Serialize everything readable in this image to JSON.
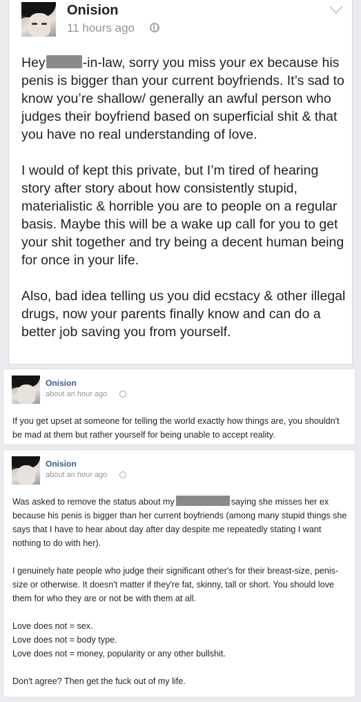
{
  "post1": {
    "author": "Onision",
    "time": "11 hours ago",
    "icons": {
      "privacy": "globe-icon",
      "menu": "chevron-down-icon"
    },
    "p1_a": "Hey",
    "p1_b": "-in-law,  sorry you miss your ex because his penis is bigger than your current boyfriends. It’s sad to know you’re shallow/ generally an awful person who judges their boyfriend based on superficial shit & that you have no real understanding of love.",
    "p2": "I would of kept this private, but I’m tired of hearing story after story about how consistently stupid, materialistic & horrible you are to people on a regular basis. Maybe this will be a wake up call for you to get your shit together and try being a decent human being for once in your life.",
    "p3": "Also, bad idea telling us you did ecstacy & other illegal drugs, now your parents finally know and can do a better job saving you from yourself."
  },
  "post2": {
    "author": "Onision",
    "time": "about an hour ago",
    "text": "If you get upset at someone for telling the world exactly how things are, you shouldn't be mad at them but rather yourself for being unable to accept reality."
  },
  "post3": {
    "author": "Onision",
    "time": "about an hour ago",
    "p1_a": "Was asked to remove the status about my",
    "p1_b": "saying she misses her ex because his penis is bigger than her current boyfriends (among many stupid things she says that I have to hear about day after day despite me repeatedly stating I want nothing to do with her).",
    "p2": "I genuinely hate people who judge their significant other's for their breast-size, penis-size or otherwise. It doesn't matter if they're fat, skinny, tall or short. You should love them for who they are or not be with them at all.",
    "l1": "Love does not = sex.",
    "l2": "Love does not = body type.",
    "l3": "Love does not = money, popularity or any other bullshit.",
    "p4": "Don't agree? Then get the fuck out of my life."
  },
  "colors": {
    "background": "#e9ebee",
    "link": "#365899",
    "muted": "#90949c",
    "text": "#1d2129",
    "redaction": "#8a8a8a"
  }
}
